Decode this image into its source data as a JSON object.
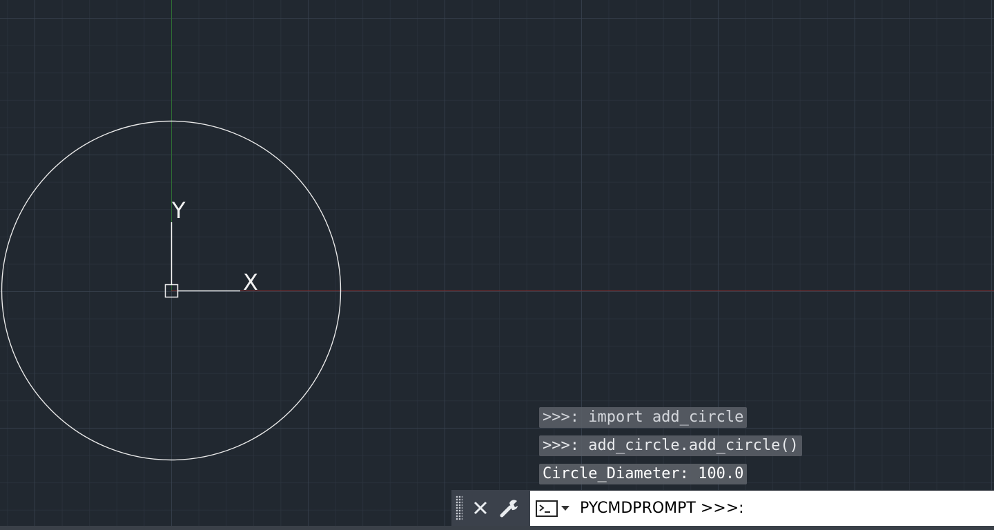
{
  "command_history": [
    ">>>: import add_circle",
    ">>>: add_circle.add_circle()",
    "Circle_Diameter: 100.0"
  ],
  "command_line": {
    "prompt_text": "PYCMDPROMPT >>>:",
    "placeholder": ""
  },
  "ucs": {
    "x_label": "X",
    "y_label": "Y"
  },
  "colors": {
    "background": "#212830",
    "x_axis": "#8a2b2b",
    "y_axis": "#2e6a34",
    "geometry": "#e8e8e8"
  },
  "icons": {
    "close": "close-icon",
    "customize": "wrench-icon",
    "command_prompt": "command-prompt-icon"
  }
}
